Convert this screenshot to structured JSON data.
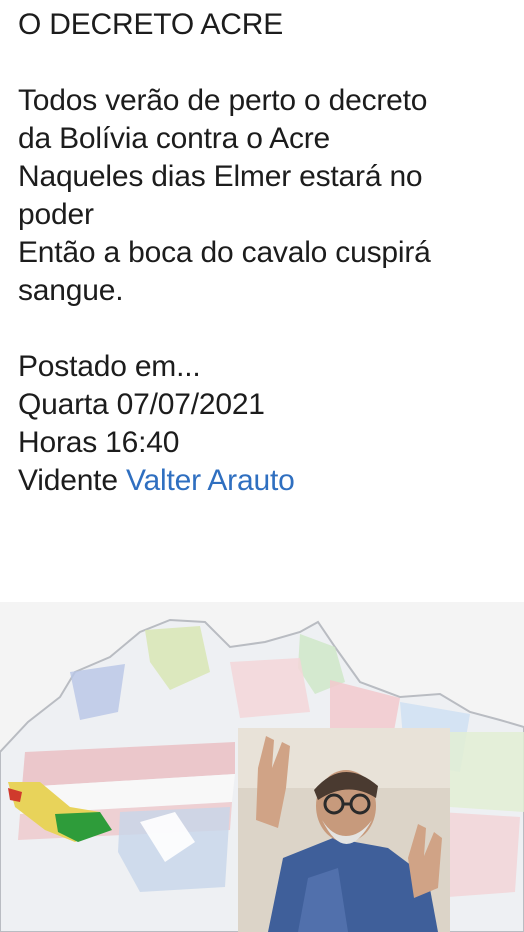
{
  "post": {
    "title": "O DECRETO ACRE",
    "body_lines": [
      "Todos verão de perto o decreto",
      "da Bolívia contra o Acre",
      "Naqueles dias Elmer estará no",
      "poder",
      "Então a boca do cavalo cuspirá",
      "sangue."
    ],
    "posted_label": "Postado em...",
    "date": "Quarta 07/07/2021",
    "time": "Horas 16:40",
    "author_prefix": "Vidente ",
    "author_name": "Valter Arauto"
  },
  "image": {
    "map_icon": "map-of-brazil-with-flags",
    "photo_icon": "man-with-raised-hands-photo",
    "highlight_color": "#2e9c3a"
  },
  "colors": {
    "link": "#2f6fc0",
    "text": "#1c1c1c"
  }
}
